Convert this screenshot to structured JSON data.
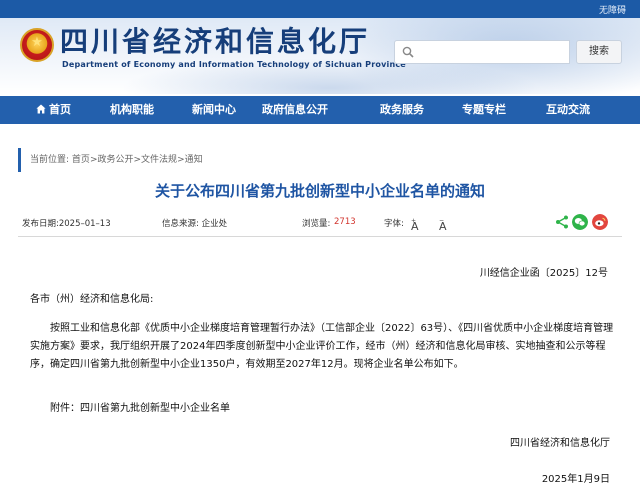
{
  "topbar": {
    "accessibility": "无障碍"
  },
  "header": {
    "site_name": "四川省经济和信息化厅",
    "site_name_en": "Department of Economy and Information Technology of Sichuan Province",
    "search_placeholder": "",
    "search_button": "搜索"
  },
  "nav": [
    {
      "label": "首页",
      "icon": "home-icon"
    },
    {
      "label": "机构职能"
    },
    {
      "label": "新闻中心"
    },
    {
      "label": "政府信息公开"
    },
    {
      "label": "政务服务"
    },
    {
      "label": "专题专栏"
    },
    {
      "label": "互动交流"
    }
  ],
  "breadcrumb": {
    "prefix": "当前位置:",
    "items": [
      "首页",
      "政务公开",
      "文件法规",
      "通知"
    ],
    "separator": ">"
  },
  "article": {
    "title": "关于公布四川省第九批创新型中小企业名单的通知",
    "meta": {
      "publish_date": "发布日期:2025–01–13",
      "source": "信息来源:  企业处",
      "views_label": "浏览量:",
      "views": "2713",
      "font_label": "字体:",
      "font_larger": "A",
      "font_smaller": "A"
    },
    "doc_number": "川经信企业函〔2025〕12号",
    "addressee": "各市（州）经济和信息化局:",
    "body": "按照工业和信息化部《优质中小企业梯度培育管理暂行办法》（工信部企业〔2022〕63号）、《四川省优质中小企业梯度培育管理实施方案》要求，我厅组织开展了2024年四季度创新型中小企业评价工作，经市（州）经济和信息化局审核、实地抽查和公示等程序，确定四川省第九批创新型中小企业1350户，有效期至2027年12月。现将企业名单公布如下。",
    "attachment": "附件：四川省第九批创新型中小企业名单",
    "signature": "四川省经济和信息化厅",
    "date": "2025年1月9日"
  },
  "colors": {
    "primary": "#2360ad",
    "title": "#1f55a3",
    "views": "#d2362f",
    "wechat": "#2fb44a",
    "weibo": "#e2463f"
  }
}
